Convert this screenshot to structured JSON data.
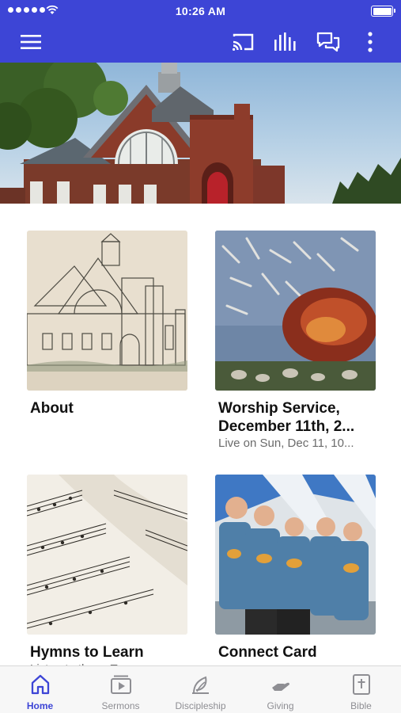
{
  "status_bar": {
    "time": "10:26 AM",
    "signal_icon": "signal-dots-icon",
    "wifi_icon": "wifi-icon",
    "battery_icon": "battery-icon"
  },
  "app_bar": {
    "color": "#3d45d6",
    "menu_icon": "hamburger-menu-icon",
    "actions": [
      "cast-icon",
      "audio-bars-icon",
      "chat-icon",
      "more-vertical-icon"
    ]
  },
  "hero": {
    "image": "church-building-photo"
  },
  "cards": [
    {
      "title": "About",
      "subtitle": "",
      "image": "church-sketch-illustration"
    },
    {
      "title_line1": "Worship Service,",
      "title_line2": "December 11th, 2...",
      "subtitle": "Live on Sun, Dec 11, 10...",
      "image": "abstract-painting"
    },
    {
      "title": "Hymns to Learn",
      "subtitle": "Listen to these T...",
      "image": "hymnal-pages-photo"
    },
    {
      "title": "Connect Card",
      "subtitle": "",
      "image": "group-photo"
    }
  ],
  "tabs": [
    {
      "label": "Home",
      "icon": "home-icon",
      "active": true
    },
    {
      "label": "Sermons",
      "icon": "video-play-icon",
      "active": false
    },
    {
      "label": "Discipleship",
      "icon": "sprout-icon",
      "active": false
    },
    {
      "label": "Giving",
      "icon": "giving-hands-icon",
      "active": false
    },
    {
      "label": "Bible",
      "icon": "bible-icon",
      "active": false
    }
  ],
  "accent_color": "#3d45d6",
  "inactive_tab_color": "#8e8e93"
}
